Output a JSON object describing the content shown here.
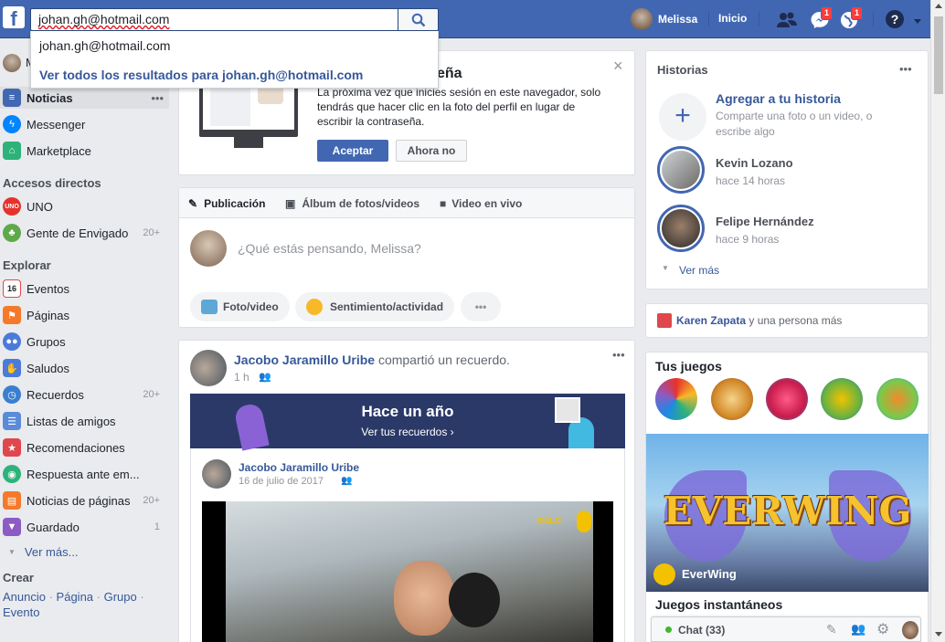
{
  "topbar": {
    "logo": "f",
    "search_value": "johan.gh@hotmail.com",
    "user_name": "Melissa",
    "home_label": "Inicio",
    "messages_badge": "1",
    "notifications_badge": "1",
    "help_label": "?"
  },
  "autocomplete": {
    "item": "johan.gh@hotmail.com",
    "see_all": "Ver todos los resultados para johan.gh@hotmail.com"
  },
  "leftnav": {
    "profile_initial": "M",
    "items": [
      {
        "label": "Noticias",
        "icon": "news-feed-icon"
      },
      {
        "label": "Messenger",
        "icon": "messenger-icon"
      },
      {
        "label": "Marketplace",
        "icon": "marketplace-icon"
      }
    ],
    "shortcuts_heading": "Accesos directos",
    "shortcuts": [
      {
        "label": "UNO",
        "count": ""
      },
      {
        "label": "Gente de Envigado",
        "count": "20+"
      }
    ],
    "explore_heading": "Explorar",
    "explore": [
      {
        "label": "Eventos",
        "count": ""
      },
      {
        "label": "Páginas",
        "count": ""
      },
      {
        "label": "Grupos",
        "count": ""
      },
      {
        "label": "Saludos",
        "count": ""
      },
      {
        "label": "Recuerdos",
        "count": "20+"
      },
      {
        "label": "Listas de amigos",
        "count": ""
      },
      {
        "label": "Recomendaciones",
        "count": ""
      },
      {
        "label": "Respuesta ante em...",
        "count": ""
      },
      {
        "label": "Noticias de páginas",
        "count": "20+"
      },
      {
        "label": "Guardado",
        "count": "1"
      }
    ],
    "see_more": "Ver más...",
    "create_heading": "Crear",
    "create_links": [
      "Anuncio",
      "Página",
      "Grupo",
      "Evento"
    ],
    "events_icon_day": "16"
  },
  "password_card": {
    "title_fragment": "eña",
    "body": "La próxima vez que inicies sesión en este navegador, solo tendrás que hacer clic en la foto del perfil en lugar de escribir la contraseña.",
    "accept": "Aceptar",
    "decline": "Ahora no",
    "close": "×"
  },
  "composer": {
    "tabs": [
      "Publicación",
      "Álbum de fotos/videos",
      "Video en vivo"
    ],
    "placeholder": "¿Qué estás pensando, Melissa?",
    "actions": [
      "Foto/video",
      "Sentimiento/actividad"
    ],
    "more": "•••"
  },
  "post": {
    "author": "Jacobo Jaramillo Uribe",
    "action": " compartió un recuerdo.",
    "time": "1 h",
    "memory_title": "Hace un año",
    "memory_link": "Ver tus recuerdos ›",
    "inner_author": "Jacobo Jaramillo Uribe",
    "inner_date": "16 de julio de 2017",
    "watermark": "XIELO",
    "more": "•••"
  },
  "stories": {
    "title": "Historias",
    "more": "•••",
    "add_title": "Agregar a tu historia",
    "add_sub": "Comparte una foto o un video, o escribe algo",
    "items": [
      {
        "name": "Kevin Lozano",
        "time": "hace 14 horas"
      },
      {
        "name": "Felipe Hernández",
        "time": "hace 9 horas"
      }
    ],
    "see_more": "Ver más"
  },
  "birthdays": {
    "name": "Karen Zapata",
    "rest": " y una persona más"
  },
  "games": {
    "title": "Tus juegos",
    "banner_title": "EVERWING",
    "banner_label": "EverWing",
    "instant_title": "Juegos instantáneos"
  },
  "chat": {
    "label": "Chat (33)"
  },
  "colors": {
    "brand": "#4267b2",
    "link": "#365899",
    "badge": "#fa3e3e",
    "online": "#42b72a"
  }
}
